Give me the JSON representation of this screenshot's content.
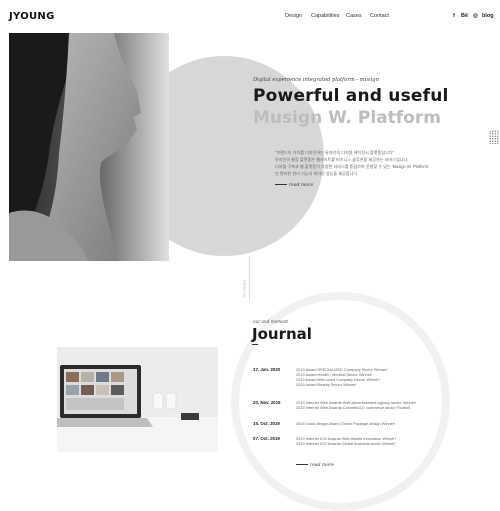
{
  "header": {
    "logo": "JYOUNG",
    "nav": [
      "Design",
      "Capabilities",
      "Cases",
      "Contact"
    ],
    "social": [
      {
        "icon": "facebook-icon",
        "label": "f"
      },
      {
        "icon": "behance-icon",
        "label": "Bē"
      },
      {
        "icon": "instagram-icon",
        "label": "◎"
      },
      {
        "icon": "blog-icon",
        "label": "blog"
      }
    ]
  },
  "hero": {
    "tagline": "Digital experience integrated platform - musign",
    "title_line1": "Powerful and useful",
    "title_line2": "Musign W. Platform",
    "description": [
      "\"브랜드의 가치를 디자인하는 뮤자인의 디지털 에이전시 플랫폼입니다\"",
      "뮤자인의 통합 플랫폼은 웹사이트를 비즈니스 솔루션을 제공하는 서비스입니다.",
      "디지털 구축과 웹 플랫폼이 다양한 서비스를 통합하여 운영할 수 있는 'Musign W. Platform'",
      "은 편리한 관리 기능과 뛰어난 성능을 제공합니다."
    ],
    "read_more": "read more",
    "vertical_label": "SERVICE"
  },
  "journal": {
    "subtitle": "our and moment",
    "title": "Journal",
    "entries": [
      {
        "date": "17. Jan. 2020",
        "items": [
          "2019 Award SPECIALIZED Company Sector Winner!",
          "2019 Award Health / Medical Sector Winner!",
          "2019 Award Web-used Company Sector Winner!",
          "2019 Award Beauty Sector Winner!"
        ]
      },
      {
        "date": "20. Nov. 2019",
        "items": [
          "2019 Internet Web Awards Web Advertisement agency sector Winner!",
          "2019 Internet Web Awards Cosmetic/LE commerce sector Finalist!"
        ]
      },
      {
        "date": "15. Oct. 2019",
        "items": [
          "2019 Good design Award Online Package design Winner!"
        ]
      },
      {
        "date": "07. Oct. 2019",
        "items": [
          "2019 Internet ICO Awards Web Assets Innovation Winner!",
          "2019 Internet ICO Awards Global business sector Winner!"
        ]
      }
    ],
    "read_more": "read more"
  },
  "colors": {
    "text": "#1a1a1a",
    "muted": "#bdbdbd",
    "circle": "#d7d7d7"
  }
}
